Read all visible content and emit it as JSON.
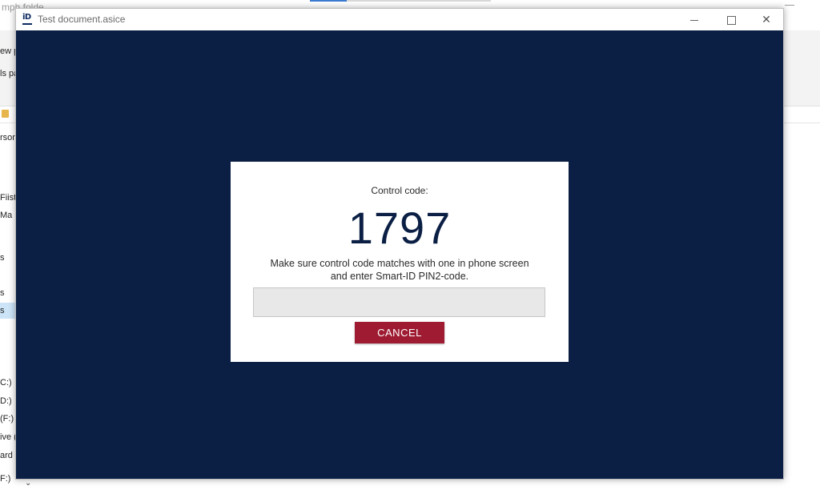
{
  "background_explorer": {
    "title_fragment": "mph folde",
    "sidebar_fragments": [
      "ew p",
      "ls pa",
      "rson",
      "Fiista",
      "Ma",
      "s",
      "s",
      "s",
      "C:)",
      "D:)",
      "(F:)",
      "ive (",
      "ard",
      "F:)"
    ]
  },
  "window": {
    "title": "Test document.asice",
    "logo_text": "iD",
    "controls": {
      "minimize_icon": "minimize-icon",
      "maximize_icon": "maximize-icon",
      "close_icon": "close-icon",
      "close_glyph": "✕"
    }
  },
  "colors": {
    "content_background": "#0b1f44",
    "cancel_button": "#9e1b32",
    "code_text": "#0b1f44"
  },
  "dialog": {
    "label": "Control code:",
    "code": "1797",
    "message_line1": "Make sure control code matches with one in phone screen",
    "message_line2": "and enter Smart-ID PIN2-code.",
    "pin_input_value": "",
    "cancel_label": "CANCEL"
  }
}
